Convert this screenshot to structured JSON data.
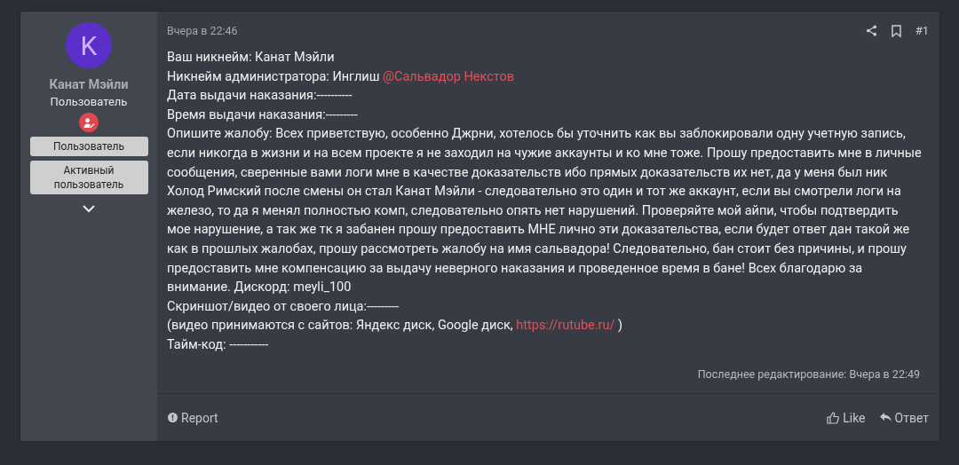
{
  "author": {
    "avatar_letter": "K",
    "name": "Канат Мэйли",
    "title": "Пользователь",
    "banners": [
      "Пользователь",
      "Активный пользователь"
    ]
  },
  "post": {
    "date": "Вчера в 22:46",
    "number": "#1",
    "lines": [
      [
        {
          "kind": "plain",
          "text": "Ваш никнейм: Канат Мэйли"
        }
      ],
      [
        {
          "kind": "plain",
          "text": "Никнейм администратора: Инглиш "
        },
        {
          "kind": "mention",
          "text": "@Сальвадор Некстов"
        }
      ],
      [
        {
          "kind": "plain",
          "text": "Дата выдачи наказания:----------"
        }
      ],
      [
        {
          "kind": "plain",
          "text": "Время выдачи наказания:---------"
        }
      ],
      [
        {
          "kind": "plain",
          "text": "Опишите жалобу: Всех приветствую, особенно Джрни, хотелось бы уточнить как вы заблокировали одну учетную запись, если никогда в жизни и на всем проекте я не заходил на чужие аккаунты и ко мне тоже. Прошу предоставить мне в личные сообщения, сверенные вами логи мне в качестве доказательств ибо прямых доказательств их нет, да у меня был ник Холод Римский после смены он стал Канат Мэйли - следовательно это один и тот же аккаунт, если вы смотрели логи на железо, то да я менял полностью комп, следовательно опять нет нарушений. Проверяйте мой айпи, чтобы подтвердить мое нарушение, а так же тк я забанен прошу предоставить МНЕ лично эти доказательства, если будет ответ дан такой же как в прошлых жалобах, прошу рассмотреть жалобу на имя сальвадора! Следовательно, бан стоит без причины, и прошу предоставить мне компенсацию за выдачу неверного наказания и проведенное время в бане! Всех благодарю за внимание. Дискорд: meyli_100"
        }
      ],
      [
        {
          "kind": "plain",
          "text": "Скриншот/видео от своего лица:---------"
        }
      ],
      [
        {
          "kind": "plain",
          "text": "(видео принимаются с сайтов: Яндекс диск, Google диск, "
        },
        {
          "kind": "link",
          "text": "https://rutube.ru/"
        },
        {
          "kind": "plain",
          "text": " )"
        }
      ],
      [
        {
          "kind": "plain",
          "text": "Тайм-код: -----------"
        }
      ]
    ],
    "last_edited": "Последнее редактирование: Вчера в 22:49",
    "actions_left": [
      "Report"
    ],
    "actions_right": [
      {
        "kind": "like",
        "label": "Like"
      },
      {
        "kind": "reply",
        "label": "Ответ"
      }
    ]
  }
}
